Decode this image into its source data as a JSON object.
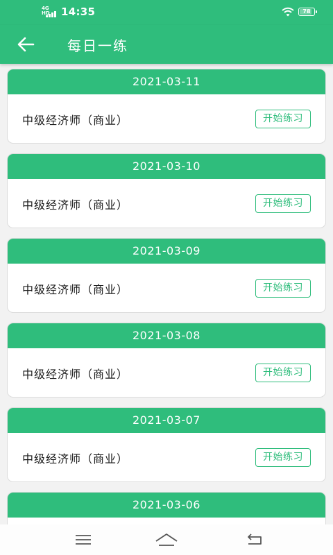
{
  "status_bar": {
    "network": "4G HD",
    "time": "14:35",
    "battery": "78",
    "wifi_icon": "wifi-icon",
    "signal_icon": "signal-icon"
  },
  "app_bar": {
    "back_icon": "arrow-left-icon",
    "title": "每日一练"
  },
  "colors": {
    "primary": "#2fbd7c",
    "background": "#f2f2f2",
    "card": "#ffffff",
    "text": "#1b1b1b"
  },
  "practice_list": [
    {
      "date": "2021-03-11",
      "subject": "中级经济师（商业）",
      "button": "开始练习"
    },
    {
      "date": "2021-03-10",
      "subject": "中级经济师（商业）",
      "button": "开始练习"
    },
    {
      "date": "2021-03-09",
      "subject": "中级经济师（商业）",
      "button": "开始练习"
    },
    {
      "date": "2021-03-08",
      "subject": "中级经济师（商业）",
      "button": "开始练习"
    },
    {
      "date": "2021-03-07",
      "subject": "中级经济师（商业）",
      "button": "开始练习"
    },
    {
      "date": "2021-03-06",
      "subject": "",
      "button": ""
    }
  ],
  "nav_bar": {
    "menu_icon": "menu-icon",
    "home_icon": "home-icon",
    "back_icon": "back-icon"
  }
}
